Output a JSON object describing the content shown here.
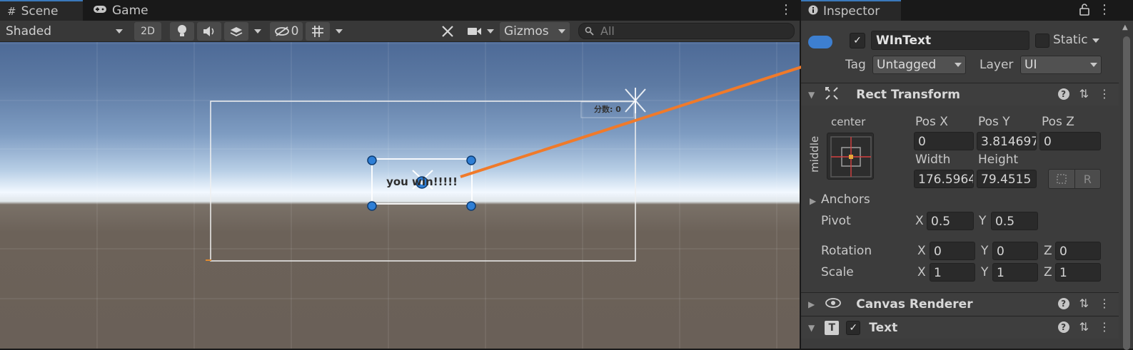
{
  "scene_tabs": {
    "scene_label": "Scene",
    "game_label": "Game"
  },
  "toolbar": {
    "draw_mode": "Shaded",
    "mode_2d": "2D",
    "hidden_count": "0",
    "gizmos_label": "Gizmos",
    "search_placeholder": "All"
  },
  "scene_content": {
    "score_text": "分数: 0",
    "win_text": "you win!!!!!"
  },
  "inspector": {
    "tab_label": "Inspector",
    "object_name": "WInText",
    "active": true,
    "static_label": "Static",
    "tag_label": "Tag",
    "tag_value": "Untagged",
    "layer_label": "Layer",
    "layer_value": "UI",
    "rect_transform": {
      "title": "Rect Transform",
      "anchor_h": "center",
      "anchor_v": "middle",
      "pos_x_label": "Pos X",
      "pos_y_label": "Pos Y",
      "pos_z_label": "Pos Z",
      "pos_x": "0",
      "pos_y": "3.814697",
      "pos_z": "0",
      "width_label": "Width",
      "height_label": "Height",
      "width": "176.5964",
      "height": "79.4515",
      "r_button": "R",
      "anchors_label": "Anchors",
      "pivot_label": "Pivot",
      "pivot_x": "0.5",
      "pivot_y": "0.5",
      "rotation_label": "Rotation",
      "rot_x": "0",
      "rot_y": "0",
      "rot_z": "0",
      "scale_label": "Scale",
      "scale_x": "1",
      "scale_y": "1",
      "scale_z": "1",
      "x_label": "X",
      "y_label": "Y",
      "z_label": "Z"
    },
    "canvas_renderer": {
      "title": "Canvas Renderer"
    },
    "text_component": {
      "title": "Text",
      "enabled": true
    }
  },
  "colors": {
    "annotation_arrow": "#f07a2a",
    "handle_blue": "#2f7fd6",
    "tab_accent": "#3a79bb"
  }
}
